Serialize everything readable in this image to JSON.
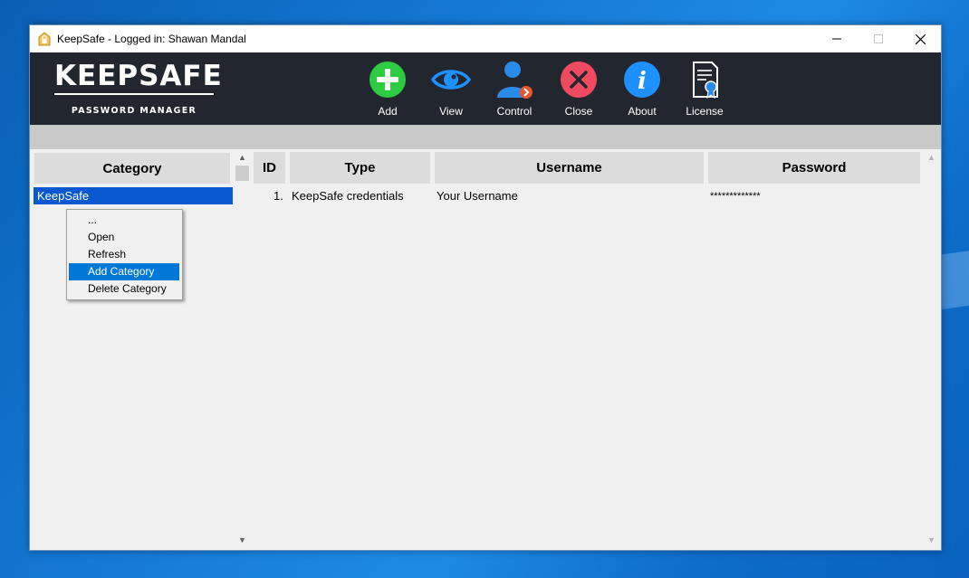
{
  "window": {
    "title": "KeepSafe - Logged in: Shawan Mandal",
    "controls": {
      "minimize": "minimize-icon",
      "maximize": "maximize-icon",
      "close": "close-icon"
    }
  },
  "logo": {
    "name": "KEEPSAFE",
    "tagline": "PASSWORD MANAGER"
  },
  "toolbar": {
    "buttons": [
      {
        "label": "Add",
        "icon": "plus-icon",
        "color": "#2ecc40"
      },
      {
        "label": "View",
        "icon": "eye-icon",
        "color": "#1e90ff"
      },
      {
        "label": "Control",
        "icon": "user-settings-icon",
        "color": "#2a8be8"
      },
      {
        "label": "Close",
        "icon": "x-icon",
        "color": "#ef4a5f"
      },
      {
        "label": "About",
        "icon": "info-icon",
        "color": "#1e90ff"
      },
      {
        "label": "License",
        "icon": "certificate-icon",
        "color": "#ffffff"
      }
    ]
  },
  "categories": {
    "header": "Category",
    "items": [
      "KeepSafe"
    ],
    "selected": "KeepSafe"
  },
  "context_menu": {
    "items": [
      "...",
      "Open",
      "Refresh",
      "Add Category",
      "Delete Category"
    ],
    "highlighted": "Add Category"
  },
  "grid": {
    "columns": [
      "ID",
      "Type",
      "Username",
      "Password"
    ],
    "rows": [
      {
        "id": "1.",
        "type": "KeepSafe credentials",
        "username": "Your Username",
        "password": "*************"
      }
    ]
  },
  "colors": {
    "toolbar_bg": "#22262e",
    "selection": "#0a58d0",
    "menu_highlight": "#0078d7"
  }
}
